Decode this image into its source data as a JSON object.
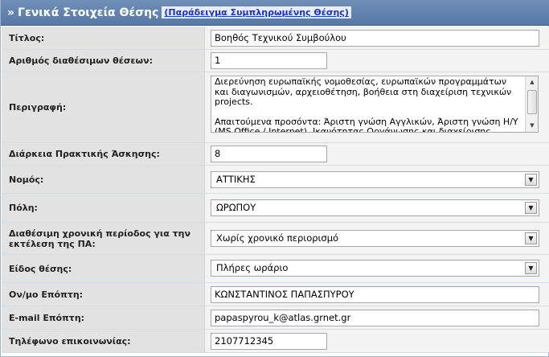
{
  "header": {
    "chevron": "»",
    "title": "Γενικά Στοιχεία Θέσης",
    "example_link": "(Παράδειγμα Συμπληρωμένης Θέσης)"
  },
  "fields": {
    "title": {
      "label": "Τίτλος:",
      "value": "Βοηθός Τεχνικού Συμβούλου"
    },
    "positions": {
      "label": "Αριθμός διαθέσιμων θέσεων:",
      "value": "1"
    },
    "description": {
      "label": "Περιγραφή:",
      "paragraph1": "Διερεύνηση ευρωπαϊκής νομοθεσίας, ευρωπαϊκών προγραμμάτων και διαγωνισμών, αρχειοθέτηση, βοήθεια στη διαχείριση τεχνικών projects.",
      "paragraph2": "Απαιτούμενα προσόντα: Άριστη γνώση Αγγλικών, Άριστη γνώση Η/Υ (MS Office / Internet), Ικανότητας Οργάνωσης και διαχείρισης χρόνου, ομαδικό πνεύμα συνεργασίας"
    },
    "duration": {
      "label": "Διάρκεια Πρακτικής Άσκησης:",
      "value": "8"
    },
    "prefecture": {
      "label": "Νομός:",
      "value": "ΑΤΤΙΚΗΣ"
    },
    "city": {
      "label": "Πόλη:",
      "value": "ΩΡΩΠΟΥ"
    },
    "period": {
      "label": "Διαθέσιμη χρονική περίοδος για την εκτέλεση της ΠΑ:",
      "value": "Χωρίς χρονικό περιορισμό"
    },
    "position_type": {
      "label": "Είδος θέσης:",
      "value": "Πλήρες ωράριο"
    },
    "supervisor": {
      "label": "Ον/μο Επόπτη:",
      "value": "ΚΩΝΣΤΑΝΤΙΝΟΣ ΠΑΠΑΣΠΥΡΟΥ"
    },
    "supervisor_email": {
      "label": "E-mail Επόπτη:",
      "value": "papaspyrou_k@atlas.grnet.gr"
    },
    "phone": {
      "label": "Τηλέφωνο επικοινωνίας:",
      "value": "2107712345"
    }
  },
  "icons": {
    "dropdown": "▼",
    "scroll_up": "▲",
    "scroll_down": "▼"
  },
  "colors": {
    "header_bg": "#5f80ad",
    "label_bg": "#e2e2e2",
    "field_bg": "#f3f3f3",
    "link": "#1a2fd6"
  }
}
